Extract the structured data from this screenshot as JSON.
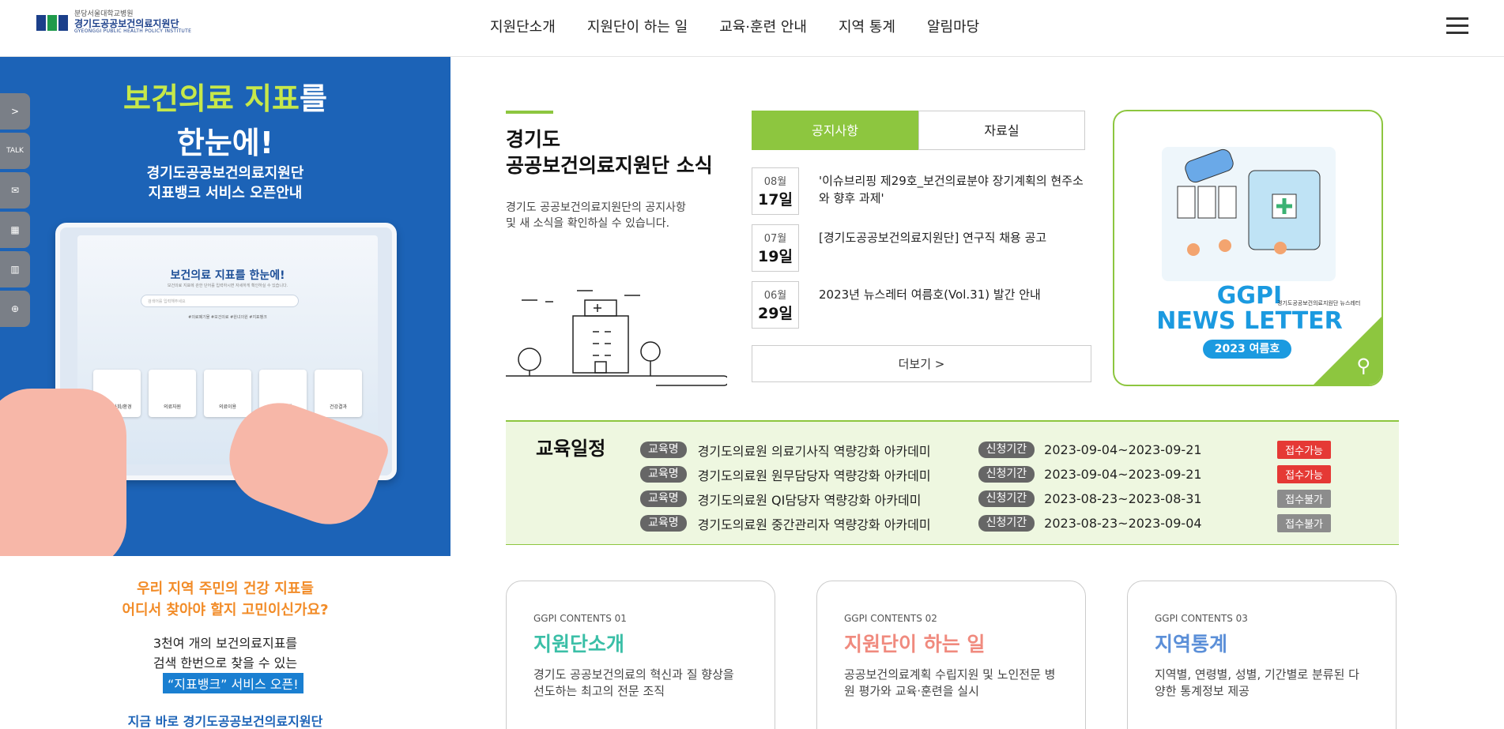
{
  "header": {
    "logo_sub": "분당서울대학교병원",
    "logo_main": "경기도공공보건의료지원단",
    "logo_en": "GYEONGGI PUBLIC HEALTH POLICY INSTITUTE",
    "nav": [
      "지원단소개",
      "지원단이 하는 일",
      "교육·훈련 안내",
      "지역 통계",
      "알림마당"
    ]
  },
  "banner": {
    "title_green": "보건의료 지표",
    "title_white": "를",
    "title_line2": "한눈에!",
    "subtitle": "경기도공공보건의료지원단\n지표뱅크 서비스 오픈안내",
    "screen_title": "보건의료 지표를 한눈에!",
    "screen_sub": "보건의료 지표에 관한 단어를 입력하시면 자세하게 확인하실 수 있습니다.",
    "screen_search": "검색어를 입력해주세요",
    "screen_tags": "#의료폐기물   #보건의료   #원녀의원   #지표뱅크",
    "screen_cards": [
      "인구/사회/환경",
      "의료자원",
      "의료이용",
      "건강행태",
      "건강결과"
    ]
  },
  "quick_menu": [
    ">",
    "TALK",
    "✉",
    "▦",
    "▥",
    "⊕"
  ],
  "left_bottom": {
    "line1": "우리 지역 주민의 건강 지표들\n어디서 찾아야 할지 고민이신가요?",
    "line2": "3천여 개의 보건의료지표를\n검색 한번으로 찾을 수 있는",
    "highlight": "“지표뱅크” 서비스 오픈!",
    "line3": "지금 바로 경기도공공보건의료지원단"
  },
  "news": {
    "title": "경기도\n공공보건의료지원단 소식",
    "desc": "경기도 공공보건의료지원단의 공지사항 및 새 소식을 확인하실 수 있습니다.",
    "tabs": [
      "공지사항",
      "자료실"
    ],
    "items": [
      {
        "month": "08월",
        "day": "17일",
        "title": "'이슈브리핑 제29호_보건의료분야 장기계획의 현주소와 향후 과제'"
      },
      {
        "month": "07월",
        "day": "19일",
        "title": "[경기도공공보건의료지원단] 연구직 채용 공고"
      },
      {
        "month": "06월",
        "day": "29일",
        "title": "2023년 뉴스레터 여름호(Vol.31) 발간 안내"
      }
    ],
    "more": "더보기 >"
  },
  "newsletter": {
    "title": "GGPI\nNEWS LETTER",
    "small": "경기도공공보건의료지원단 뉴스레터",
    "badge": "2023 여름호"
  },
  "schedule": {
    "title": "교육일정",
    "name_label": "교육명",
    "period_label": "신청기간",
    "rows": [
      {
        "name": "경기도의료원 의료기사직 역량강화 아카데미",
        "period": "2023-09-04~2023-09-21",
        "status": "접수가능",
        "open": true
      },
      {
        "name": "경기도의료원 원무담당자 역량강화 아카데미",
        "period": "2023-09-04~2023-09-21",
        "status": "접수가능",
        "open": true
      },
      {
        "name": "경기도의료원 QI담당자 역량강화 아카데미",
        "period": "2023-08-23~2023-08-31",
        "status": "접수불가",
        "open": false
      },
      {
        "name": "경기도의료원 중간관리자 역량강화 아카데미",
        "period": "2023-08-23~2023-09-04",
        "status": "접수불가",
        "open": false
      }
    ]
  },
  "contents": [
    {
      "label": "GGPI CONTENTS 01",
      "title": "지원단소개",
      "desc": "경기도 공공보건의료의 혁신과 질 향상을 선도하는 최고의 전문 조직",
      "color": "#3bbfa7"
    },
    {
      "label": "GGPI CONTENTS 02",
      "title": "지원단이 하는 일",
      "desc": "공공보건의료계획 수립지원 및 노인전문 병원 평가와 교육·훈련을 실시",
      "color": "#f08a7e"
    },
    {
      "label": "GGPI CONTENTS 03",
      "title": "지역통계",
      "desc": "지역별, 연령별, 성별, 기간별로 분류된 다양한 통계정보 제공",
      "color": "#5b8fd8"
    }
  ],
  "colors": {
    "accent": "#8dc63f",
    "brand_blue": "#1c63b7"
  }
}
